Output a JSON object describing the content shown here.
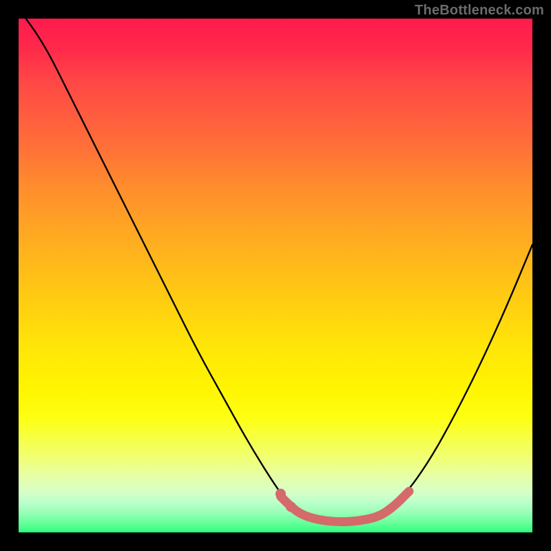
{
  "branding": {
    "text": "TheBottleneck.com"
  },
  "colors": {
    "page_bg": "#000000",
    "curve_main": "#000000",
    "curve_highlight": "#d46a6a",
    "branding_text": "#6b6b6b"
  },
  "chart_data": {
    "type": "line",
    "title": "",
    "xlabel": "",
    "ylabel": "",
    "xlim": [
      0,
      1
    ],
    "ylim": [
      0,
      1
    ],
    "series": [
      {
        "name": "main_curve",
        "x": [
          0.0,
          0.05,
          0.1,
          0.15,
          0.2,
          0.25,
          0.3,
          0.35,
          0.4,
          0.45,
          0.5,
          0.53,
          0.56,
          0.6,
          0.65,
          0.7,
          0.75,
          0.8,
          0.85,
          0.9,
          0.95,
          1.0
        ],
        "y": [
          1.02,
          0.95,
          0.85,
          0.75,
          0.65,
          0.55,
          0.45,
          0.35,
          0.26,
          0.17,
          0.09,
          0.05,
          0.03,
          0.02,
          0.02,
          0.03,
          0.07,
          0.14,
          0.23,
          0.33,
          0.44,
          0.56
        ]
      },
      {
        "name": "highlight_segment",
        "x": [
          0.51,
          0.53,
          0.55,
          0.58,
          0.62,
          0.66,
          0.7,
          0.73,
          0.76
        ],
        "y": [
          0.07,
          0.05,
          0.035,
          0.025,
          0.02,
          0.022,
          0.03,
          0.05,
          0.08
        ]
      }
    ],
    "highlight_dots": [
      {
        "x": 0.51,
        "y": 0.075
      },
      {
        "x": 0.53,
        "y": 0.05
      }
    ]
  }
}
